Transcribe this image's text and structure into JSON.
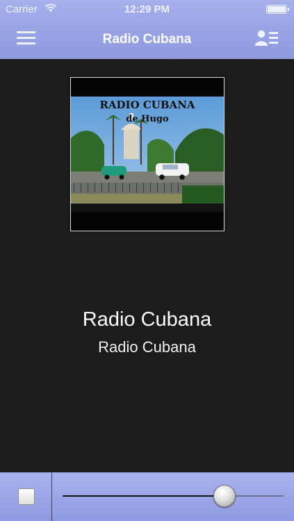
{
  "status_bar": {
    "carrier": "Carrier",
    "time": "12:29 PM"
  },
  "nav": {
    "title": "Radio Cubana",
    "menu_icon": "hamburger-menu-icon",
    "profile_icon": "contact-list-icon"
  },
  "artwork": {
    "line1": "RADIO CUBANA",
    "line2": "de Hugo"
  },
  "now_playing": {
    "title": "Radio Cubana",
    "subtitle": "Radio Cubana"
  },
  "player": {
    "stop_icon": "stop-icon",
    "volume_level": 0.73
  },
  "colors": {
    "bar": "#9aa4e6",
    "background": "#1c1c1c"
  }
}
